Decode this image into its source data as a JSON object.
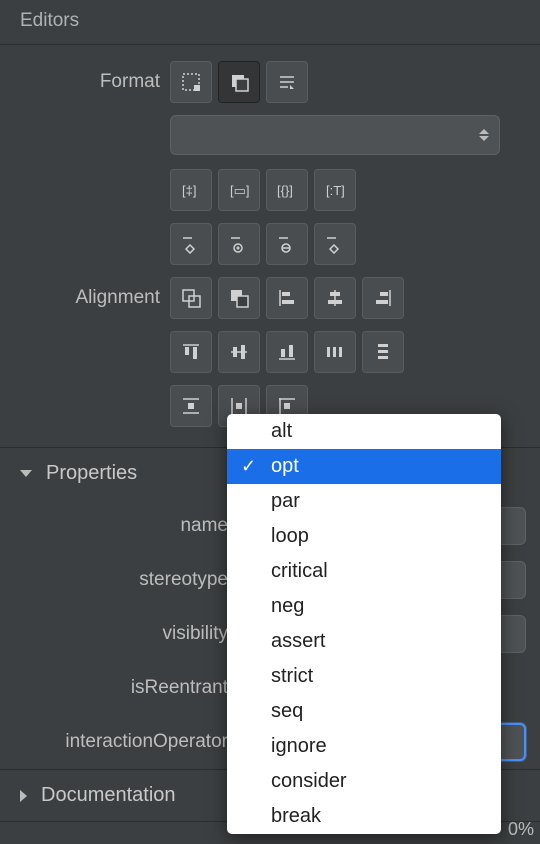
{
  "panel": {
    "title": "Editors"
  },
  "format": {
    "label": "Format",
    "dropdown_value": ""
  },
  "alignment": {
    "label": "Alignment"
  },
  "properties": {
    "header": "Properties",
    "expanded": true,
    "rows": {
      "name": "name",
      "stereotype": "stereotype",
      "visibility": "visibility",
      "isReentrant": "isReentrant",
      "interactionOperator": "interactionOperator"
    }
  },
  "documentation": {
    "header": "Documentation",
    "expanded": false
  },
  "popup": {
    "selected_index": 1,
    "items": [
      "alt",
      "opt",
      "par",
      "loop",
      "critical",
      "neg",
      "assert",
      "strict",
      "seq",
      "ignore",
      "consider",
      "break"
    ]
  },
  "zoom": "0%"
}
